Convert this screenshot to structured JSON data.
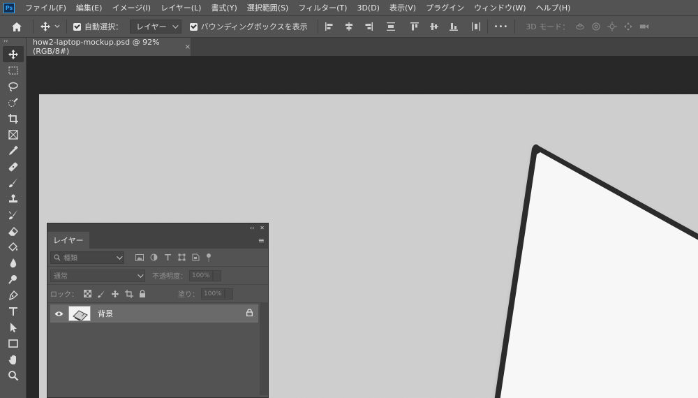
{
  "app": {
    "logo": "Ps"
  },
  "menu": [
    "ファイル(F)",
    "編集(E)",
    "イメージ(I)",
    "レイヤー(L)",
    "書式(Y)",
    "選択範囲(S)",
    "フィルター(T)",
    "3D(D)",
    "表示(V)",
    "プラグイン",
    "ウィンドウ(W)",
    "ヘルプ(H)"
  ],
  "options": {
    "auto_select_label": "自動選択：",
    "auto_select_checked": true,
    "target_value": "レイヤー",
    "bounding_box_label": "バウンディングボックスを表示",
    "bounding_box_checked": true,
    "mode_3d_label": "3D モード：",
    "more_label": "•••"
  },
  "document": {
    "tab_title": "how2-laptop-mockup.psd @ 92% (RGB/8#)",
    "close": "×"
  },
  "toolbar": {
    "collapse": "››"
  },
  "layers_panel": {
    "collapse": "‹‹",
    "close": "✕",
    "tab_label": "レイヤー",
    "menu_icon": "≡",
    "filter_placeholder": "種類",
    "blend_mode": "通常",
    "opacity_label": "不透明度：",
    "opacity_value": "100%",
    "lock_label": "ロック：",
    "fill_label": "塗り：",
    "fill_value": "100%",
    "layers": [
      {
        "name": "背景",
        "visible": true,
        "locked": true
      }
    ]
  },
  "colors": {
    "ui_bg": "#535353",
    "dark_bg": "#282828",
    "canvas": "#cfcfcf",
    "selected_layer": "#6a6a6a"
  }
}
